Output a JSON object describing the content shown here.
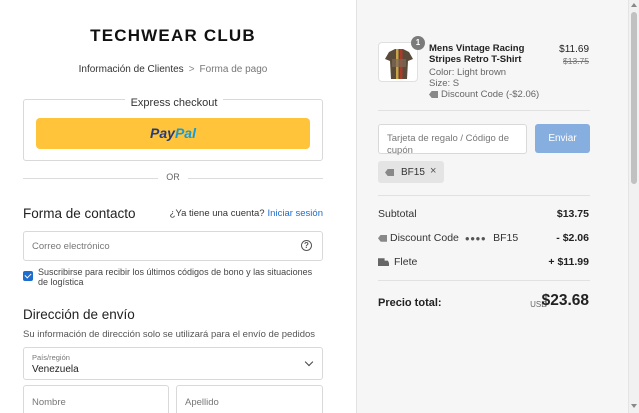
{
  "header": {
    "logo": "TECHWEAR CLUB",
    "breadcrumb": {
      "step1": "Información de Clientes",
      "separator": ">",
      "step2": "Forma de pago"
    }
  },
  "express": {
    "title": "Express checkout",
    "paypal_part1": "Pay",
    "paypal_part2": "Pal"
  },
  "or_label": "OR",
  "contact": {
    "heading": "Forma de contacto",
    "question": "¿Ya tiene una cuenta?",
    "login_link": "Iniciar sesión",
    "email_placeholder": "Correo electrónico",
    "help_symbol": "?",
    "subscribe_label": "Suscribirse para recibir los últimos códigos de bono y las situaciones de logística",
    "subscribe_checked": true
  },
  "shipping": {
    "heading": "Dirección de envío",
    "subtitle": "Su información de dirección solo se utilizará para el envío de pedidos",
    "country_label": "País/región",
    "country_value": "Venezuela",
    "first_name_placeholder": "Nombre",
    "last_name_placeholder": "Apellido"
  },
  "summary": {
    "product": {
      "quantity": "1",
      "title": "Mens Vintage Racing Stripes Retro T-Shirt",
      "color": "Color: Light brown",
      "size": "Size: S",
      "discount": "Discount Code (-$2.06)",
      "price": "$11.69",
      "original_price": "$13.75"
    },
    "gift_placeholder": "Tarjeta de regalo / Código de cupón",
    "send_label": "Enviar",
    "applied_code": "BF15",
    "remove_symbol": "×",
    "subtotal_label": "Subtotal",
    "subtotal_value": "$13.75",
    "discount_label": "Discount Code",
    "discount_dots": "●●●●",
    "discount_code": "BF15",
    "discount_value": "- $2.06",
    "shipping_label": "Flete",
    "shipping_value": "+ $11.99",
    "total_label": "Precio total:",
    "currency": "USD",
    "total_value": "$23.68"
  },
  "colors": {
    "accent": "#1e6dce",
    "paypal_yellow": "#ffc439",
    "send_button": "#86aedf",
    "summary_bg": "#f6f6f6"
  }
}
